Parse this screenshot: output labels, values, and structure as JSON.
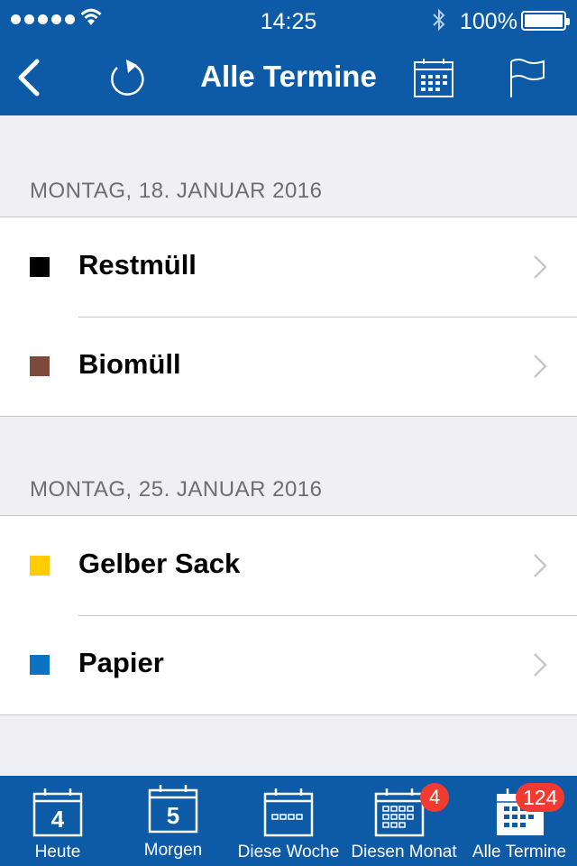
{
  "status_bar": {
    "time": "14:25",
    "battery": "100%"
  },
  "navbar": {
    "title": "Alle Termine",
    "back_icon": "chevron-left-icon",
    "refresh_icon": "refresh-icon",
    "calendar_icon": "calendar-grid-icon",
    "flag_icon": "flag-icon"
  },
  "sections": [
    {
      "header": "MONTAG, 18. JANUAR 2016",
      "items": [
        {
          "label": "Restmüll",
          "color": "#000000"
        },
        {
          "label": "Biomüll",
          "color": "#7b4a3a"
        }
      ]
    },
    {
      "header": "MONTAG, 25. JANUAR 2016",
      "items": [
        {
          "label": "Gelber Sack",
          "color": "#ffcc00"
        },
        {
          "label": "Papier",
          "color": "#0c72c2"
        }
      ]
    }
  ],
  "tabbar": {
    "tabs": [
      {
        "label": "Heute",
        "icon_text": "4"
      },
      {
        "label": "Morgen",
        "icon_text": "5"
      },
      {
        "label": "Diese Woche"
      },
      {
        "label": "Diesen Monat",
        "badge": "4"
      },
      {
        "label": "Alle Termine",
        "badge": "124"
      }
    ]
  },
  "colors": {
    "brand": "#0d5aa7",
    "badge": "#f23b30",
    "background": "#efeff4"
  }
}
